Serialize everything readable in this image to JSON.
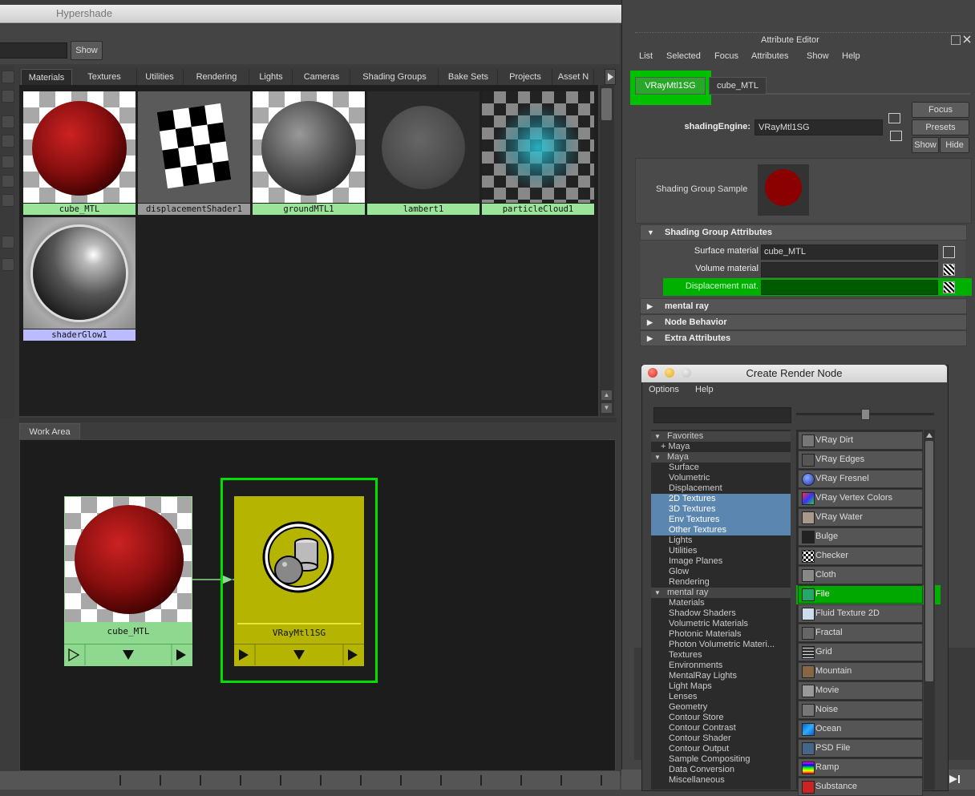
{
  "hypershade": {
    "title": "Hypershade",
    "show_button": "Show",
    "tabs": [
      "Materials",
      "Textures",
      "Utilities",
      "Rendering",
      "Lights",
      "Cameras",
      "Shading Groups",
      "Bake Sets",
      "Projects",
      "Asset N"
    ],
    "swatches": [
      "cube_MTL",
      "displacementShader1",
      "groundMTL1",
      "lambert1",
      "particleCloud1",
      "shaderGlow1"
    ],
    "work_area_tab": "Work Area",
    "nodes": {
      "material": "cube_MTL",
      "shading_group": "VRayMtl1SG"
    }
  },
  "attribute_editor": {
    "title": "Attribute Editor",
    "menu": [
      "List",
      "Selected",
      "Focus",
      "Attributes",
      "Show",
      "Help"
    ],
    "tabs": [
      "VRayMtl1SG",
      "cube_MTL"
    ],
    "shading_engine_label": "shadingEngine:",
    "shading_engine_value": "VRayMtl1SG",
    "buttons": {
      "focus": "Focus",
      "presets": "Presets",
      "show": "Show",
      "hide": "Hide"
    },
    "sample_label": "Shading Group Sample",
    "sample_color": "#8b0000",
    "sections": {
      "shading_group_attributes": "Shading Group Attributes",
      "mental_ray": "mental ray",
      "node_behavior": "Node Behavior",
      "extra_attributes": "Extra Attributes"
    },
    "attributes": {
      "surface_label": "Surface material",
      "surface_value": "cube_MTL",
      "volume_label": "Volume material",
      "volume_value": "",
      "displacement_label": "Displacement mat.",
      "displacement_value": ""
    }
  },
  "create_render_node": {
    "title": "Create Render Node",
    "menu": [
      "Options",
      "Help"
    ],
    "tree": [
      {
        "label": "Favorites",
        "type": "head"
      },
      {
        "label": "+ Maya",
        "type": "sub"
      },
      {
        "label": "Maya",
        "type": "head"
      },
      {
        "label": "Surface",
        "type": "item"
      },
      {
        "label": "Volumetric",
        "type": "item"
      },
      {
        "label": "Displacement",
        "type": "item"
      },
      {
        "label": "2D Textures",
        "type": "sel"
      },
      {
        "label": "3D Textures",
        "type": "sel"
      },
      {
        "label": "Env Textures",
        "type": "sel"
      },
      {
        "label": "Other Textures",
        "type": "sel"
      },
      {
        "label": "Lights",
        "type": "item"
      },
      {
        "label": "Utilities",
        "type": "item"
      },
      {
        "label": "Image Planes",
        "type": "item"
      },
      {
        "label": "Glow",
        "type": "item"
      },
      {
        "label": "Rendering",
        "type": "item"
      },
      {
        "label": "mental ray",
        "type": "head"
      },
      {
        "label": "Materials",
        "type": "item"
      },
      {
        "label": "Shadow Shaders",
        "type": "item"
      },
      {
        "label": "Volumetric Materials",
        "type": "item"
      },
      {
        "label": "Photonic Materials",
        "type": "item"
      },
      {
        "label": "Photon Volumetric Materi...",
        "type": "item"
      },
      {
        "label": "Textures",
        "type": "item"
      },
      {
        "label": "Environments",
        "type": "item"
      },
      {
        "label": "MentalRay Lights",
        "type": "item"
      },
      {
        "label": "Light Maps",
        "type": "item"
      },
      {
        "label": "Lenses",
        "type": "item"
      },
      {
        "label": "Geometry",
        "type": "item"
      },
      {
        "label": "Contour Store",
        "type": "item"
      },
      {
        "label": "Contour Contrast",
        "type": "item"
      },
      {
        "label": "Contour Shader",
        "type": "item"
      },
      {
        "label": "Contour Output",
        "type": "item"
      },
      {
        "label": "Sample Compositing",
        "type": "item"
      },
      {
        "label": "Data Conversion",
        "type": "item"
      },
      {
        "label": "Miscellaneous",
        "type": "item"
      }
    ],
    "nodes": [
      {
        "label": "VRay Dirt",
        "icon": "vray-dirt-icon",
        "color": "#777"
      },
      {
        "label": "VRay Edges",
        "icon": "vray-edges-icon",
        "color": "#555"
      },
      {
        "label": "VRay Fresnel",
        "icon": "vray-fresnel-icon",
        "color": "#3a5fcf"
      },
      {
        "label": "VRay Vertex Colors",
        "icon": "vray-vertex-colors-icon",
        "color": "#c33"
      },
      {
        "label": "VRay Water",
        "icon": "vray-water-icon",
        "color": "#a98"
      },
      {
        "label": "Bulge",
        "icon": "bulge-icon",
        "color": "#222"
      },
      {
        "label": "Checker",
        "icon": "checker-icon",
        "color": "#fff"
      },
      {
        "label": "Cloth",
        "icon": "cloth-icon",
        "color": "#888"
      },
      {
        "label": "File",
        "icon": "file-icon",
        "color": "#2a6"
      },
      {
        "label": "Fluid Texture 2D",
        "icon": "fluid-texture-2d-icon",
        "color": "#cde"
      },
      {
        "label": "Fractal",
        "icon": "fractal-icon",
        "color": "#666"
      },
      {
        "label": "Grid",
        "icon": "grid-icon",
        "color": "#444"
      },
      {
        "label": "Mountain",
        "icon": "mountain-icon",
        "color": "#864"
      },
      {
        "label": "Movie",
        "icon": "movie-icon",
        "color": "#999"
      },
      {
        "label": "Noise",
        "icon": "noise-icon",
        "color": "#777"
      },
      {
        "label": "Ocean",
        "icon": "ocean-icon",
        "color": "#17a"
      },
      {
        "label": "PSD File",
        "icon": "psd-file-icon",
        "color": "#468"
      },
      {
        "label": "Ramp",
        "icon": "ramp-icon",
        "color": "#c3c"
      },
      {
        "label": "Substance",
        "icon": "substance-icon",
        "color": "#c22"
      }
    ]
  }
}
